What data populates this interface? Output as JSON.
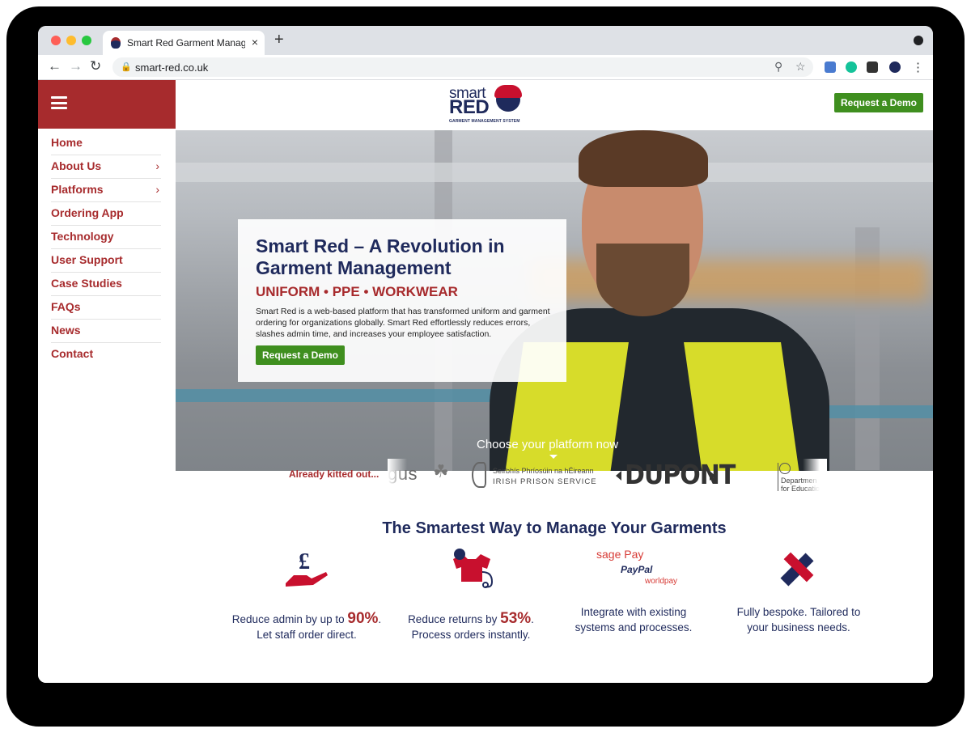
{
  "browser": {
    "tab_title": "Smart Red Garment Manageme",
    "tab_close": "×",
    "new_tab": "+",
    "url": "smart-red.co.uk",
    "back": "←",
    "forward": "→",
    "reload": "↻"
  },
  "sidebar": {
    "items": [
      {
        "label": "Home",
        "has_submenu": false
      },
      {
        "label": "About Us",
        "has_submenu": true
      },
      {
        "label": "Platforms",
        "has_submenu": true
      },
      {
        "label": "Ordering App",
        "has_submenu": false
      },
      {
        "label": "Technology",
        "has_submenu": false
      },
      {
        "label": "User Support",
        "has_submenu": false
      },
      {
        "label": "Case Studies",
        "has_submenu": false
      },
      {
        "label": "FAQs",
        "has_submenu": false
      },
      {
        "label": "News",
        "has_submenu": false
      },
      {
        "label": "Contact",
        "has_submenu": false
      }
    ],
    "chevron": "›"
  },
  "header": {
    "logo_smart": "smart",
    "logo_red": "RED",
    "logo_tagline": "GARMENT MANAGEMENT SYSTEM",
    "cta": "Request a Demo"
  },
  "hero": {
    "title": "Smart Red – A Revolution in Garment Management",
    "subtitle": "UNIFORM • PPE • WORKWEAR",
    "description": "Smart Red is a web-based platform that has transformed uniform and garment ordering for organizations globally. Smart Red effortlessly reduces errors, slashes admin time, and increases your employee satisfaction.",
    "cta": "Request a Demo",
    "choose": "Choose your platform now"
  },
  "clients": {
    "label": "Already kitted out...",
    "angus": "gus",
    "clover": "☘",
    "ips_line1": "Seirbhís Phríosúin na hÉireann",
    "ips_line2": "IRISH PRISON SERVICE",
    "dupont": "DUPONT",
    "dfe_line1": "Departmen",
    "dfe_line2": "for Educatio"
  },
  "section_title": "The Smartest Way to Manage Your Garments",
  "features": [
    {
      "pre": "Reduce admin by up to ",
      "big": "90%",
      "post": ".",
      "line2": "Let staff order direct."
    },
    {
      "pre": "Reduce returns by ",
      "big": "53%",
      "post": ".",
      "line2": "Process orders instantly."
    },
    {
      "line1": "Integrate with existing",
      "line2": "systems and processes."
    },
    {
      "line1": "Fully bespoke. Tailored to",
      "line2": "your business needs."
    }
  ],
  "payments": {
    "sage": "sage Pay",
    "paypal": "PayPal",
    "worldpay": "worldpay"
  },
  "icons": {
    "pound_symbol": "£",
    "pound_icon": "pound-hand-icon",
    "garment_icon": "tshirt-stethoscope-icon",
    "tools_icon": "pencil-ruler-icon"
  },
  "colors": {
    "brand_red": "#a72b2d",
    "navy": "#1f2a5c",
    "green": "#3f8f1f"
  }
}
